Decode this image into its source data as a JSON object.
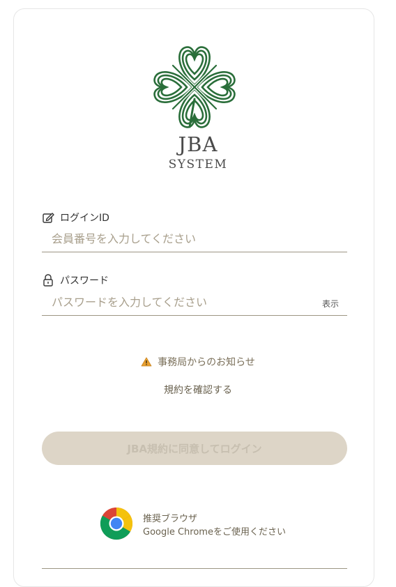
{
  "brand": {
    "name": "JBA",
    "subtitle": "SYSTEM"
  },
  "login_id": {
    "label": "ログインID",
    "placeholder": "会員番号を入力してください",
    "value": ""
  },
  "password": {
    "label": "パスワード",
    "placeholder": "パスワードを入力してください",
    "value": "",
    "show_label": "表示"
  },
  "notice": {
    "text": "事務局からのお知らせ"
  },
  "terms": {
    "link_text": "規約を確認する"
  },
  "login_button": {
    "label": "JBA規約に同意してログイン",
    "state": "disabled"
  },
  "browser": {
    "title": "推奨ブラウザ",
    "description": "Google Chromeをご使用ください"
  },
  "icons": {
    "logo": "clover-logo",
    "login_id": "edit-icon",
    "password": "lock-icon",
    "notice": "warning-icon",
    "browser": "chrome-icon"
  },
  "colors": {
    "brand_green": "#2a6e3a",
    "accent_muted": "#9c9583",
    "button_disabled_bg": "#ddd5c7",
    "warning": "#e8a030"
  }
}
